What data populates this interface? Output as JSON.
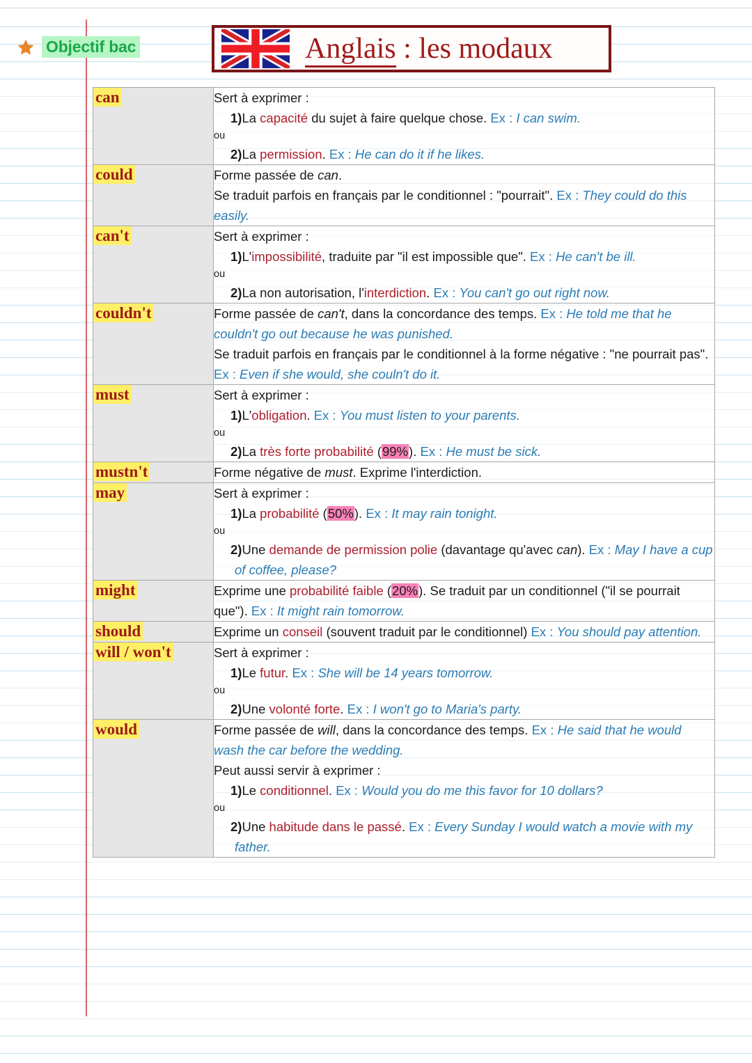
{
  "page": {
    "badge": {
      "icon": "star-icon",
      "label": "Objectif bac"
    },
    "title": {
      "flag": "uk-flag-icon",
      "underlined": "Anglais",
      "rest": " : les modaux"
    },
    "colors": {
      "keyword_red": "#ad1f2c",
      "example_blue": "#2b7cb5",
      "modal_name_red": "#9c1b16",
      "modal_highlight_yellow": "#ffef66",
      "percent_highlight_pink": "#fa81b8",
      "badge_green_text": "#1aa84a",
      "badge_green_highlight": "#b6f5c4",
      "title_border_dark_red": "#7a1517",
      "title_text_red": "#a01b1b",
      "star_orange": "#e8862a",
      "rule_line_blue": "#cfe3ee",
      "margin_line_red": "#d4626a",
      "left_column_gray": "#e6e6e6"
    }
  },
  "rows": [
    {
      "modal": "can",
      "intro": "Sert à exprimer :",
      "items": [
        {
          "num": "1)",
          "lead": "La ",
          "kw": "capacité",
          "tail": " du sujet à faire quelque chose. ",
          "ex_label": "Ex : ",
          "ex": "I can swim."
        },
        {
          "num": "2)",
          "lead": "La ",
          "kw": "permission",
          "tail": ". ",
          "ex_label": "Ex : ",
          "ex": "He can do it if he likes."
        }
      ],
      "ou": "ou"
    },
    {
      "modal": "could",
      "p1_a": "Forme passée de ",
      "p1_it": "can",
      "p1_b": ".",
      "p2_a": "Se traduit parfois en français par le conditionnel : \"pourrait\". ",
      "p2_ex_label": "Ex : ",
      "p2_ex": "They could do this easily."
    },
    {
      "modal": "can't",
      "intro": "Sert à exprimer :",
      "items": [
        {
          "num": "1)",
          "lead": "L'",
          "kw": "impossibilité",
          "tail": ", traduite par \"il est impossible que\". ",
          "ex_label": "Ex : ",
          "ex": "He can't be ill."
        },
        {
          "num": "2)",
          "lead": "La non autorisation, l'",
          "kw": "interdiction",
          "tail": ". ",
          "ex_label": "Ex : ",
          "ex": "You can't go out right now."
        }
      ],
      "ou": "ou"
    },
    {
      "modal": "couldn't",
      "p1_a": "Forme passée de ",
      "p1_it": "can't",
      "p1_b": ", dans la concordance des temps. ",
      "p1_ex_label": "Ex : ",
      "p1_ex": "He told me that he couldn't go out because he was punished.",
      "p2_a": "Se traduit parfois en français par le conditionnel à la forme négative : \"ne pourrait pas\". ",
      "p2_ex_label": "Ex : ",
      "p2_ex": "Even if she would, she couln't do it."
    },
    {
      "modal": "must",
      "intro": "Sert à exprimer :",
      "items": [
        {
          "num": "1)",
          "lead": "L'",
          "kw": "obligation",
          "tail": ". ",
          "ex_label": "Ex : ",
          "ex": "You must listen to your parents."
        },
        {
          "num": "2)",
          "lead": "La ",
          "kw": "très forte probabilité",
          "mid": " (",
          "pct": "99%",
          "tail": "). ",
          "ex_label": "Ex : ",
          "ex": "He must be sick."
        }
      ],
      "ou": "ou"
    },
    {
      "modal": "mustn't",
      "p1_a": "Forme négative de ",
      "p1_it": "must",
      "p1_b": ". Exprime l'interdiction."
    },
    {
      "modal": "may",
      "intro": "Sert à exprimer :",
      "items": [
        {
          "num": "1)",
          "lead": "La ",
          "kw": "probabilité",
          "mid": " (",
          "pct": "50%",
          "tail": "). ",
          "ex_label": "Ex : ",
          "ex": "It may rain tonight."
        },
        {
          "num": "2)",
          "lead": "Une ",
          "kw": "demande de permission polie",
          "tail_a": " (davantage qu'avec ",
          "tail_it": "can",
          "tail_b": "). ",
          "ex_label": "Ex : ",
          "ex": "May I have a cup of coffee, please?"
        }
      ],
      "ou": "ou"
    },
    {
      "modal": "might",
      "p1_a": "Exprime une ",
      "p1_kw": "probabilité faible",
      "p1_mid": " (",
      "p1_pct": "20%",
      "p1_b": "). Se traduit par un conditionnel (\"il se pourrait que\"). ",
      "p1_ex_label": "Ex : ",
      "p1_ex": "It might rain tomorrow."
    },
    {
      "modal": "should",
      "p1_a": "Exprime un ",
      "p1_kw": "conseil",
      "p1_b": " (souvent traduit par le conditionnel) ",
      "p1_ex_label": "Ex : ",
      "p1_ex": "You should pay attention."
    },
    {
      "modal": "will / won't",
      "intro": "Sert à exprimer :",
      "items": [
        {
          "num": "1)",
          "lead": "Le ",
          "kw": "futur",
          "tail": ". ",
          "ex_label": "Ex : ",
          "ex": "She will be 14 years tomorrow."
        },
        {
          "num": "2)",
          "lead": "Une ",
          "kw": "volonté forte",
          "tail": ". ",
          "ex_label": "Ex : ",
          "ex": "I won't go to Maria's party."
        }
      ],
      "ou": "ou"
    },
    {
      "modal": "would",
      "p1_a": "Forme passée de ",
      "p1_it": "will",
      "p1_b": ", dans la concordance des temps. ",
      "p1_ex_label": "Ex : ",
      "p1_ex": "He said that he would wash the car before the wedding.",
      "intro": "Peut aussi servir à exprimer :",
      "items": [
        {
          "num": "1)",
          "lead": "Le ",
          "kw": "conditionnel",
          "tail": ". ",
          "ex_label": "Ex : ",
          "ex": "Would you do me this favor for 10 dollars?"
        },
        {
          "num": "2)",
          "lead": "Une ",
          "kw": "habitude dans le passé",
          "tail": ". ",
          "ex_label": "Ex : ",
          "ex": "Every Sunday I would watch a movie with my father."
        }
      ],
      "ou": "ou"
    }
  ]
}
